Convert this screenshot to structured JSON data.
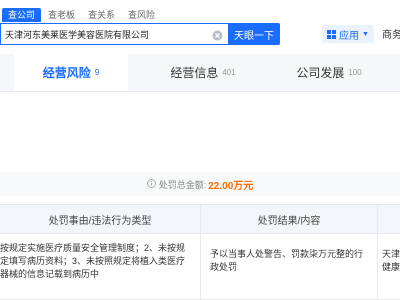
{
  "search": {
    "tabs": [
      "查公司",
      "查老板",
      "查关系",
      "查风险"
    ],
    "query": "天津河东美莱医学美容医院有限公司",
    "button_label": "天眼一下"
  },
  "header": {
    "app_menu_label": "应用",
    "right_link_label": "商务"
  },
  "tabs": [
    {
      "label": "经营风险",
      "count": "9"
    },
    {
      "label": "经营信息",
      "count": "401"
    },
    {
      "label": "公司发展",
      "count": "100"
    }
  ],
  "summary": {
    "prefix": "处罚总金额:",
    "amount": "22.00万元"
  },
  "table": {
    "headers": [
      "处罚事由/违法行为类型",
      "处罚结果/内容"
    ],
    "rows": [
      {
        "reason": "按规定实施医疗质量安全管理制度；2、未按规定填写病历资料；3、未按照规定将植入类医疗器械的信息记载到病历中",
        "result": "予以当事人处警告、罚款柒万元整的行政处罚",
        "authority": "天津健康"
      }
    ]
  },
  "colors": {
    "accent": "#1a6dff",
    "amount": "#ff6b00"
  }
}
